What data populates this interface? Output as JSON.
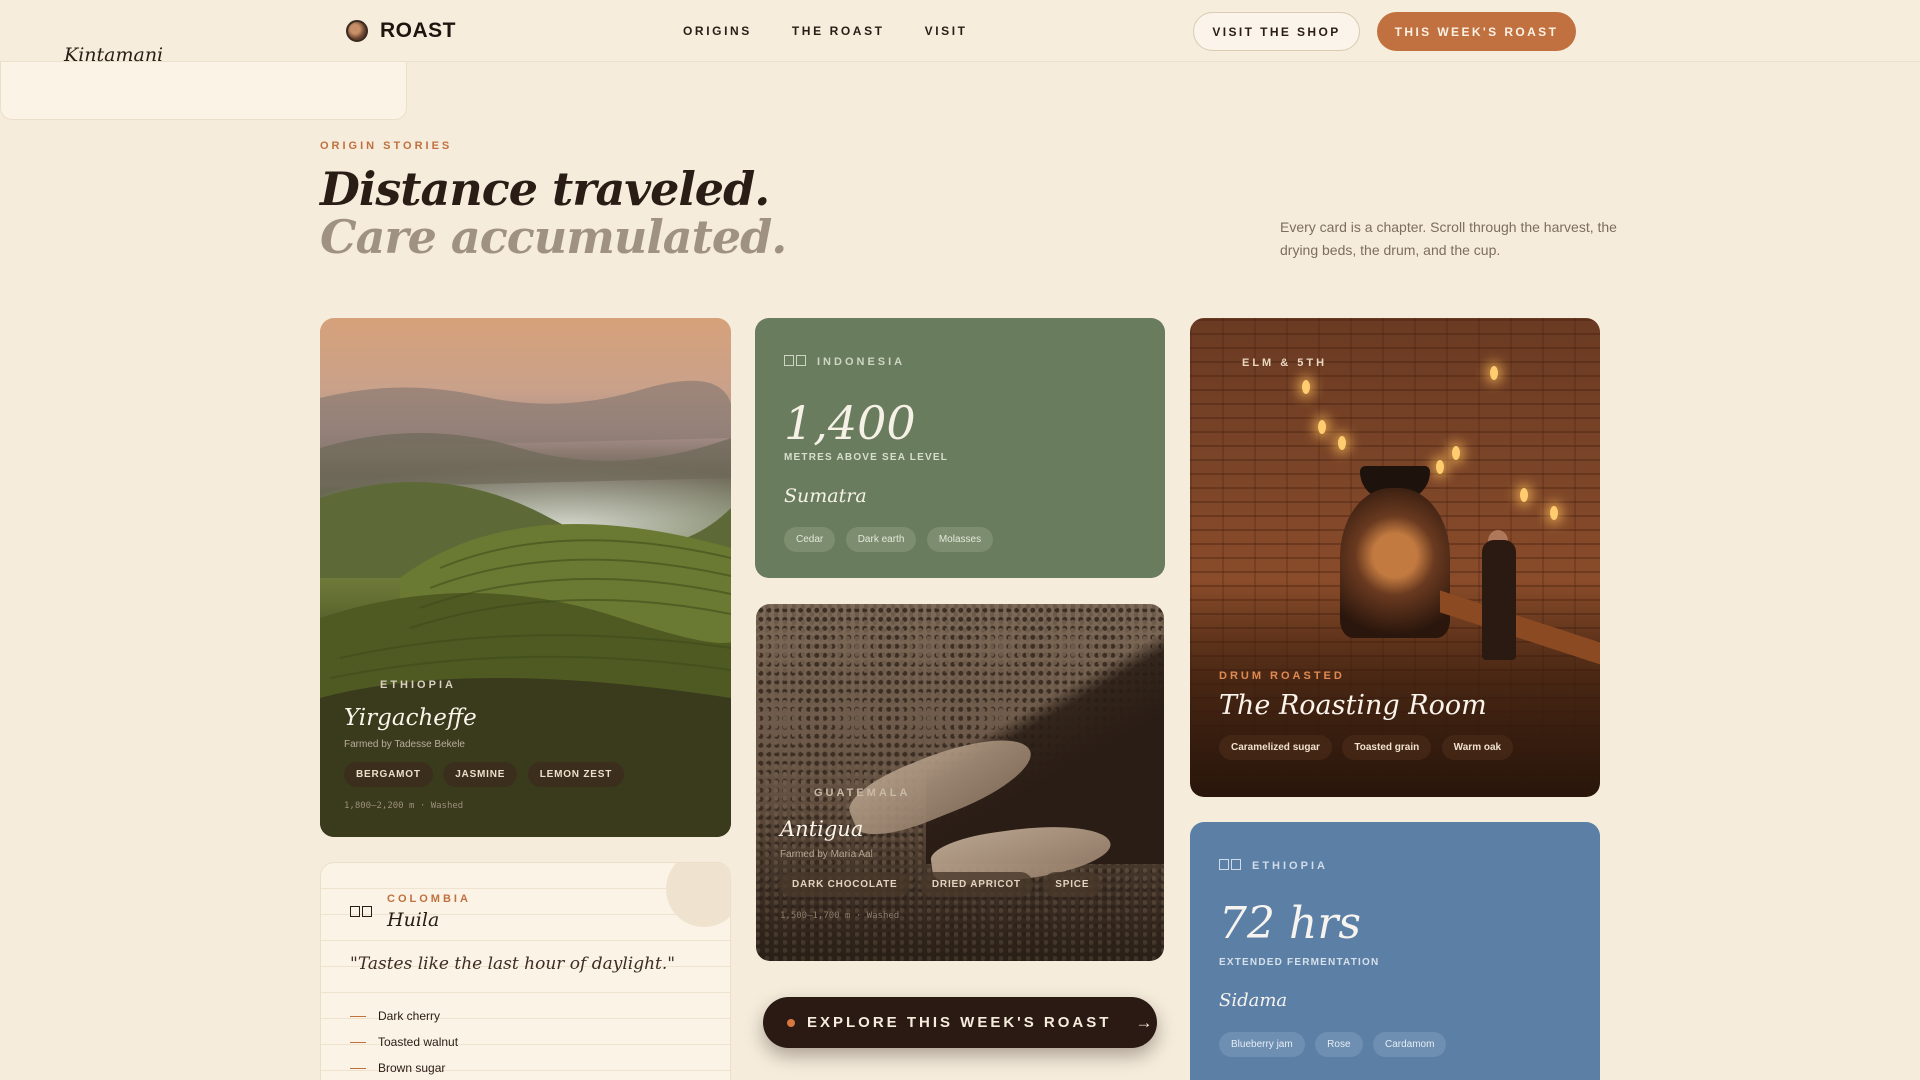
{
  "nav": {
    "brand": "ROAST",
    "links": [
      "ORIGINS",
      "THE ROAST",
      "VISIT"
    ],
    "shop_label": "VISIT THE SHOP",
    "week_label": "THIS WEEK'S ROAST",
    "accent": "#c0713f"
  },
  "hero": {
    "eyebrow": "ORIGIN STORIES",
    "line1": "Distance traveled.",
    "line2": "Care accumulated.",
    "description": "Every card is a chapter. Scroll through the harvest, the drying beds, the drum, and the cup."
  },
  "cards": {
    "yirgacheffe": {
      "origin": "ETHIOPIA",
      "title": "Yirgacheffe",
      "farmer": "Farmed by Tadesse Bekele",
      "notes": [
        "BERGAMOT",
        "JASMINE",
        "LEMON ZEST"
      ],
      "meta": "1,800–2,200 m · Washed"
    },
    "sumatra": {
      "origin": "INDONESIA",
      "stat": "1,400",
      "stat_label": "METRES ABOVE SEA LEVEL",
      "title": "Sumatra",
      "notes": [
        "Cedar",
        "Dark earth",
        "Molasses"
      ],
      "color": "#6a7c5e"
    },
    "antigua": {
      "origin": "GUATEMALA",
      "title": "Antigua",
      "farmer": "Farmed by María Aal",
      "notes": [
        "DARK CHOCOLATE",
        "DRIED APRICOT",
        "SPICE"
      ],
      "meta": "1,500–1,700 m · Washed"
    },
    "roasting_room": {
      "location": "ELM & 5TH",
      "eyebrow": "DRUM ROASTED",
      "title": "The Roasting Room",
      "notes": [
        "Caramelized sugar",
        "Toasted grain",
        "Warm oak"
      ]
    },
    "sidama": {
      "origin": "ETHIOPIA",
      "stat": "72 hrs",
      "stat_label": "EXTENDED FERMENTATION",
      "title": "Sidama",
      "notes": [
        "Blueberry jam",
        "Rose",
        "Cardamom"
      ],
      "color": "#5c7fa6"
    },
    "huila": {
      "origin": "COLOMBIA",
      "title": "Huila",
      "quote": "\"Tastes like the last hour of daylight.\"",
      "notes": [
        "Dark cherry",
        "Toasted walnut",
        "Brown sugar"
      ]
    },
    "kintamani": {
      "title": "Kintamani"
    }
  },
  "cta": {
    "label": "EXPLORE THIS WEEK'S ROAST",
    "arrow": "→"
  },
  "icons": [
    "brand-logo-icon",
    "origin-icon",
    "arrow-right-icon",
    "dash-icon"
  ]
}
